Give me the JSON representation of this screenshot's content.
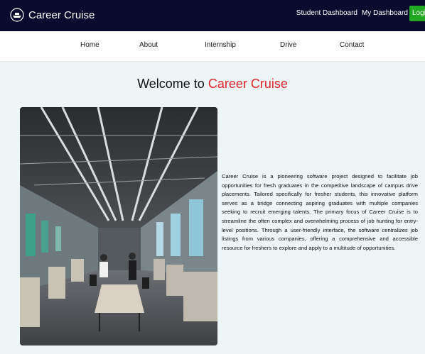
{
  "header": {
    "brand_name": "Career Cruise",
    "brand_icon": "ship-icon",
    "links": [
      "Student Dashboard",
      "My Dashboard"
    ],
    "login_label": "Login",
    "background": "#0a0a2e",
    "login_color": "#22a722"
  },
  "nav": {
    "items": [
      "Home",
      "About",
      "Internship",
      "Drive",
      "Contact"
    ]
  },
  "main": {
    "welcome_prefix": "Welcome to",
    "welcome_accent": "Career Cruise",
    "accent_color": "#e3222a",
    "description": "Career Cruise is a pioneering software project designed to facilitate job opportunities for fresh graduates in the competitive landscape of campus drive placements. Tailored specifically for fresher students, this innovative platform serves as a bridge connecting aspiring graduates with multiple companies seeking to recruit emerging talents. The primary focus of Career Cruise is to streamline the often complex and overwhelming process of job hunting for entry-level positions. Through a user-friendly interface, the software centralizes job listings from various companies, offering a comprehensive and accessible resource for freshers to explore and apply to a multitude of opportunities."
  }
}
